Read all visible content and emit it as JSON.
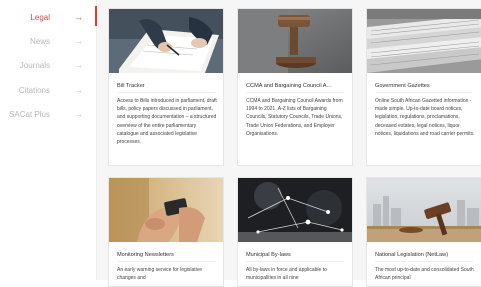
{
  "sidebar": {
    "items": [
      {
        "label": "Legal",
        "active": true
      },
      {
        "label": "News",
        "active": false
      },
      {
        "label": "Journals",
        "active": false
      },
      {
        "label": "Citations",
        "active": false
      },
      {
        "label": "SACat Plus",
        "active": false
      }
    ],
    "arrow_icon": "arrow-right-icon",
    "accent_color": "#e0463a"
  },
  "cards": [
    {
      "title": "Bill Tracker",
      "desc": "Access to Bills introduced in parliament, draft bills, policy papers discussed in parliament, and supporting documentation – a structured overview of the entire parliamentary catalogue and associated legislative processes.",
      "image": "signing-document-photo"
    },
    {
      "title": "CCMA and Bargaining Council A...",
      "desc": "CCMA and Bargaining Council Awards from 1994 to 2021. A-Z lists of Bargaining Councils, Statutory Councils, Trade Unions, Trade Union Federations, and Employer Organisations.",
      "image": "gavel-photo"
    },
    {
      "title": "Government Gazettes",
      "desc": "Online South African Gazetted information - made simple. Up-to-date board notices, legislation, regulations, proclamations, deceased estates, legal notices, liquor notices, liquidations and road carrier permits.",
      "image": "newspaper-stack-photo"
    },
    {
      "title": "Monitoring Newsletters",
      "desc": "An early warning service for legislative changes and",
      "image": "smartphone-hands-photo"
    },
    {
      "title": "Municipal By-laws",
      "desc": "All by-laws in force and applicable to municipalities in all nine",
      "image": "digital-network-photo"
    },
    {
      "title": "National Legislation (NetLaw)",
      "desc": "The most up-to-date and consolidated South African principal",
      "image": "gavel-skyline-photo"
    }
  ]
}
